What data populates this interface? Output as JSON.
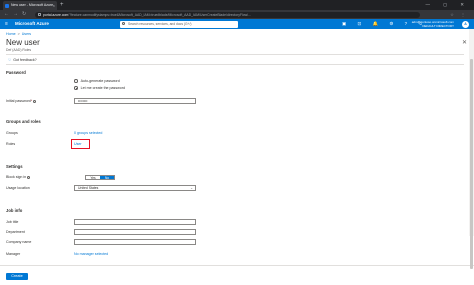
{
  "browser": {
    "tab_title": "New user - Microsoft Azure",
    "tab_close": "×",
    "new_tab": "+",
    "window_controls": "— ◻ ✕",
    "nav_icons": {
      "back": "←",
      "forward": "→",
      "reload": "↻"
    },
    "url_host": "portal.azure.com",
    "url_path": "/?feature.canmodifystamps=true&Microsoft_AAD_IAM=true#blade/Microsoft_AAD_IAM/UserCreateBlade/directoryFlow/...",
    "toolbar_icons": "☆ ⋮"
  },
  "azure_header": {
    "menu_icon": "≡",
    "brand": "Microsoft Azure",
    "search_placeholder": "Search resources, services, and docs (G+/)",
    "icons": "▣ ⊡ 🔔 ⚙ ? ☺",
    "account_name": "adm@contoso.onmicrosoft.com",
    "account_tenant": "DEFAULT DIRECTORY",
    "avatar_initial": "A"
  },
  "blade": {
    "breadcrumb": [
      "Home",
      "Users"
    ],
    "breadcrumb_sep": ">",
    "title": "New user",
    "subtitle": "Def (AAD) Roles",
    "close": "✕",
    "feedback_icon": "♡",
    "feedback": "Got feedback?"
  },
  "password": {
    "section": "Password",
    "options": [
      "Auto-generate password",
      "Let me create the password"
    ],
    "selected": 1,
    "initial_label": "Initial password",
    "required_mark": "*",
    "initial_value": "••••••••"
  },
  "groups_roles": {
    "section": "Groups and roles",
    "groups_label": "Groups",
    "groups_value": "0 groups selected",
    "roles_label": "Roles",
    "roles_value": "User"
  },
  "settings": {
    "section": "Settings",
    "block_label": "Block sign in",
    "block_options": [
      "Yes",
      "No"
    ],
    "block_selected": "No",
    "usage_label": "Usage location",
    "usage_value": "United States",
    "chevron": "⌄"
  },
  "job_info": {
    "section": "Job info",
    "job_title_label": "Job title",
    "department_label": "Department",
    "company_label": "Company name",
    "manager_label": "Manager",
    "manager_value": "No manager selected"
  },
  "footer": {
    "create": "Create"
  }
}
